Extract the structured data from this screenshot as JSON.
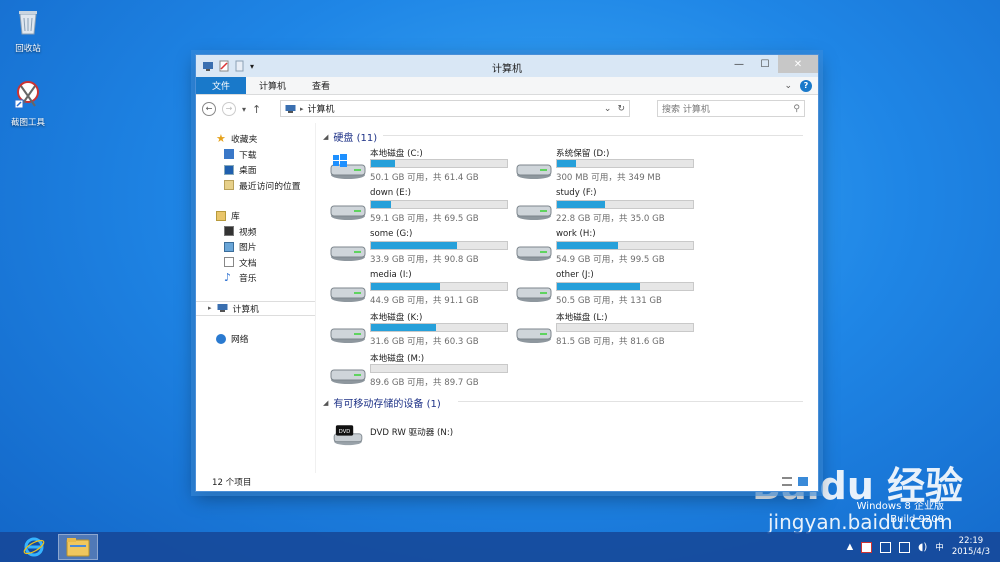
{
  "desktop": {
    "icons": [
      {
        "label": "回收站"
      },
      {
        "label": "截图工具"
      }
    ]
  },
  "window": {
    "title": "计算机",
    "ribbon_tabs": [
      "文件",
      "计算机",
      "查看"
    ],
    "address_path": "计算机",
    "search_placeholder": "搜索 计算机",
    "status_text": "12 个项目"
  },
  "nav": {
    "favorites": "收藏夹",
    "favorites_items": [
      "下载",
      "桌面",
      "最近访问的位置"
    ],
    "library": "库",
    "library_items": [
      "视频",
      "图片",
      "文档",
      "音乐"
    ],
    "computer": "计算机",
    "network": "网络"
  },
  "groups": {
    "hard_disks": "硬盘 (11)",
    "removable": "有可移动存储的设备 (1)"
  },
  "drives": [
    {
      "name": "本地磁盘 (C:)",
      "info": "50.1 GB 可用，共 61.4 GB",
      "used_fraction": 0.18,
      "os": true
    },
    {
      "name": "系统保留 (D:)",
      "info": "300 MB 可用，共 349 MB",
      "used_fraction": 0.14
    },
    {
      "name": "down (E:)",
      "info": "59.1 GB 可用，共 69.5 GB",
      "used_fraction": 0.15
    },
    {
      "name": "study (F:)",
      "info": "22.8 GB 可用，共 35.0 GB",
      "used_fraction": 0.35
    },
    {
      "name": "some (G:)",
      "info": "33.9 GB 可用，共 90.8 GB",
      "used_fraction": 0.63
    },
    {
      "name": "work (H:)",
      "info": "54.9 GB 可用，共 99.5 GB",
      "used_fraction": 0.45
    },
    {
      "name": "media (I:)",
      "info": "44.9 GB 可用，共 91.1 GB",
      "used_fraction": 0.51
    },
    {
      "name": "other (J:)",
      "info": "50.5 GB 可用，共 131 GB",
      "used_fraction": 0.61
    },
    {
      "name": "本地磁盘 (K:)",
      "info": "31.6 GB 可用，共 60.3 GB",
      "used_fraction": 0.48
    },
    {
      "name": "本地磁盘 (L:)",
      "info": "81.5 GB 可用，共 81.6 GB",
      "used_fraction": 0.0
    },
    {
      "name": "本地磁盘 (M:)",
      "info": "89.6 GB 可用，共 89.7 GB",
      "used_fraction": 0.0
    }
  ],
  "dvd": {
    "name": "DVD RW 驱动器 (N:)",
    "badge": "DVD"
  },
  "taskbar": {
    "ime": "中",
    "time": "22:19",
    "date": "2015/4/3"
  },
  "watermark": {
    "line1": "Windows 8 企业版",
    "line2": "Build 9200",
    "baidu": "Baidu 经验",
    "baidu_url": "jingyan.baidu.com"
  },
  "colors": {
    "accent": "#1979ca",
    "bar_fill": "#26a0da",
    "group_heading": "#1e3287"
  }
}
